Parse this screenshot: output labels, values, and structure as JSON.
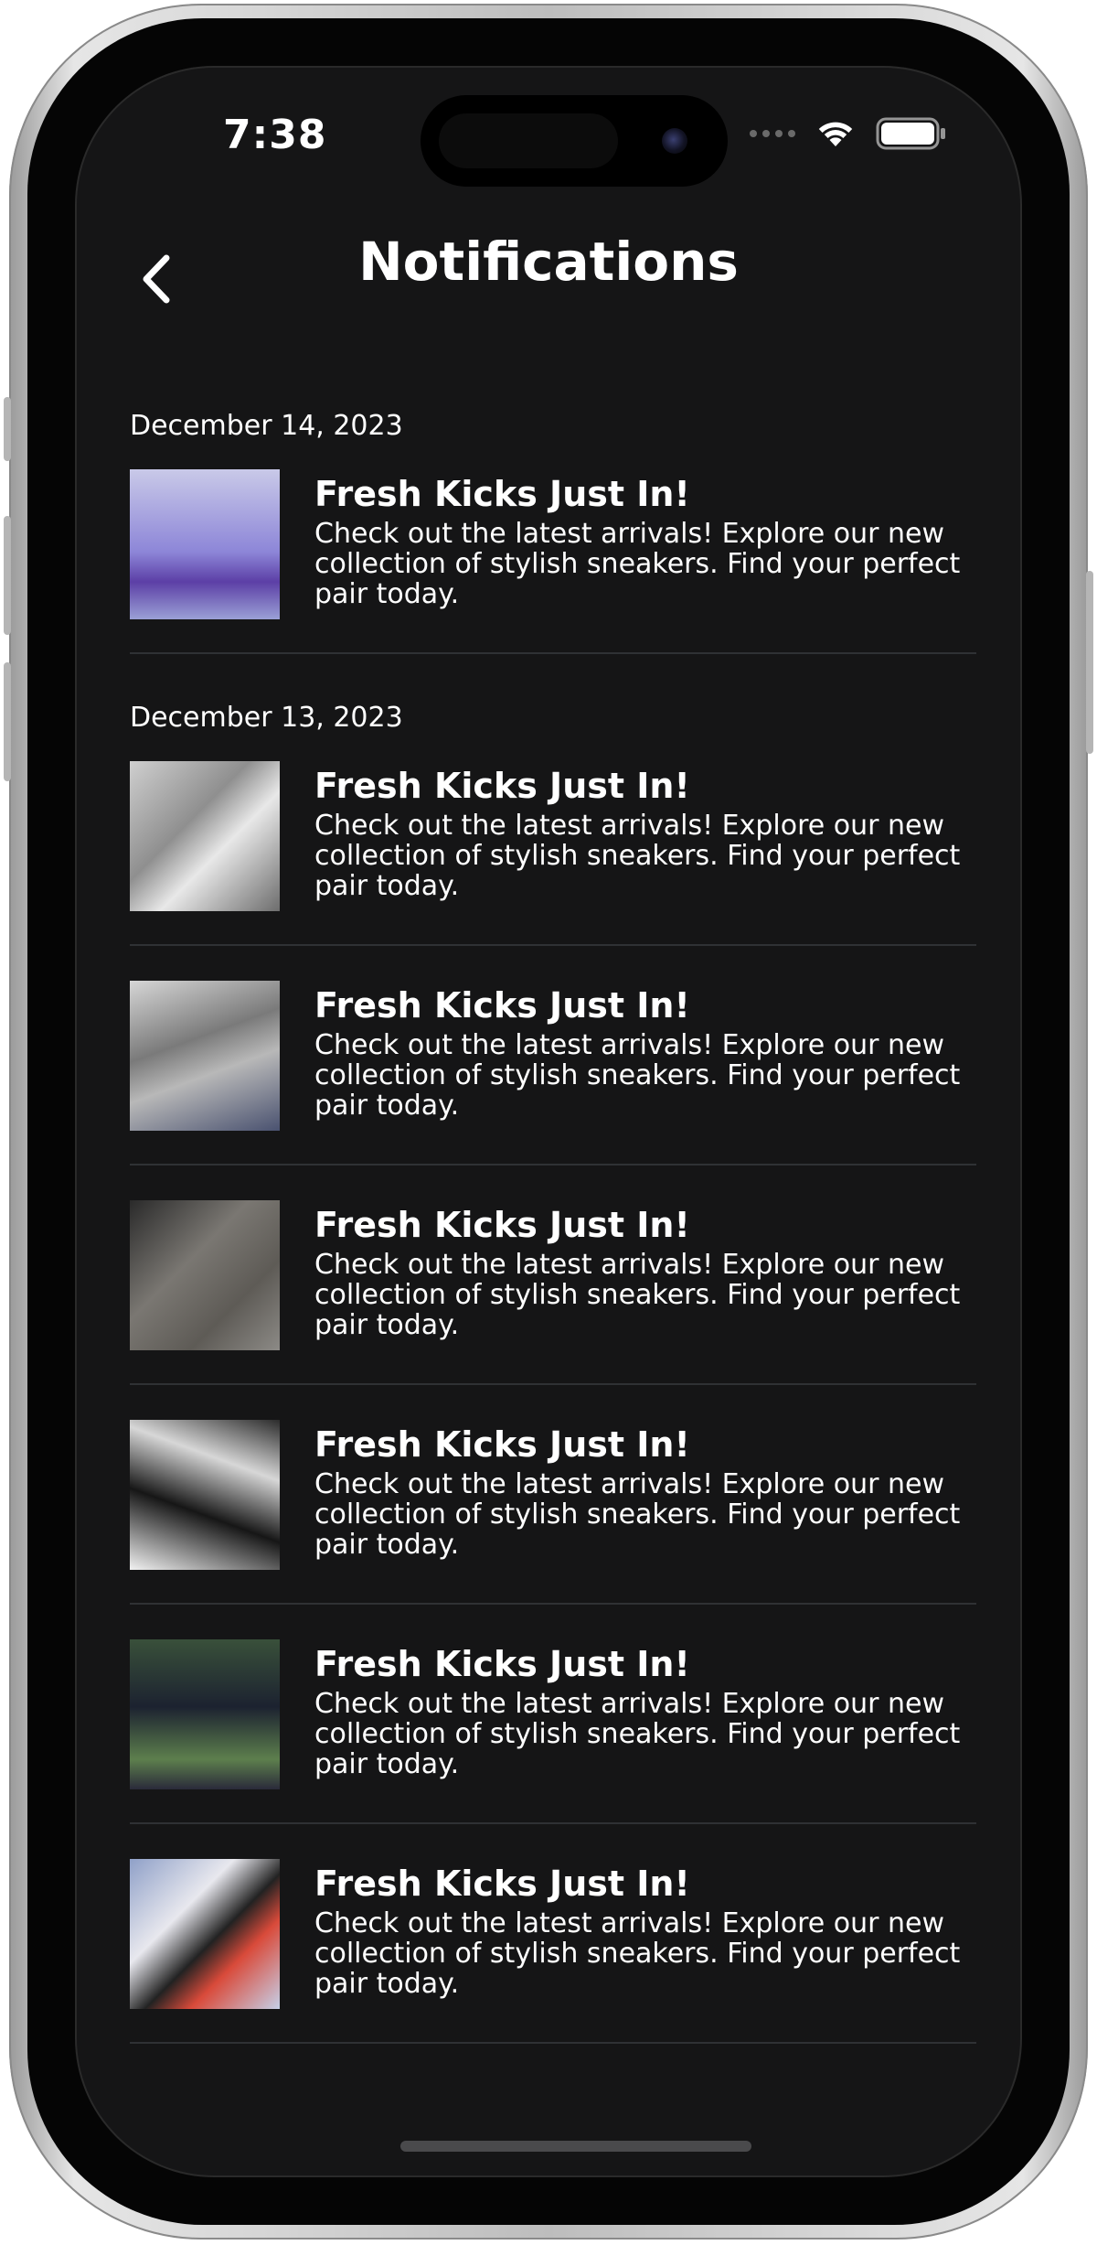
{
  "status_bar": {
    "time": "7:38"
  },
  "header": {
    "title": "Notifications",
    "back_icon": "chevron-left-icon"
  },
  "groups": [
    {
      "date": "December 14, 2023",
      "items": [
        {
          "title": "Fresh Kicks Just In!",
          "body": "Check out the latest arrivals! Explore our new collection of stylish sneakers. Find your perfect pair today."
        }
      ]
    },
    {
      "date": "December 13, 2023",
      "items": [
        {
          "title": "Fresh Kicks Just In!",
          "body": "Check out the latest arrivals! Explore our new collection of stylish sneakers. Find your perfect pair today."
        },
        {
          "title": "Fresh Kicks Just In!",
          "body": "Check out the latest arrivals! Explore our new collection of stylish sneakers. Find your perfect pair today."
        },
        {
          "title": "Fresh Kicks Just In!",
          "body": "Check out the latest arrivals! Explore our new collection of stylish sneakers. Find your perfect pair today."
        },
        {
          "title": "Fresh Kicks Just In!",
          "body": "Check out the latest arrivals! Explore our new collection of stylish sneakers. Find your perfect pair today."
        },
        {
          "title": "Fresh Kicks Just In!",
          "body": "Check out the latest arrivals! Explore our new collection of stylish sneakers. Find your perfect pair today."
        },
        {
          "title": "Fresh Kicks Just In!",
          "body": "Check out the latest arrivals! Explore our new collection of stylish sneakers. Find your perfect pair today."
        }
      ]
    }
  ],
  "colors": {
    "background": "#151516",
    "text": "#ffffff",
    "divider": "#2f3134"
  }
}
